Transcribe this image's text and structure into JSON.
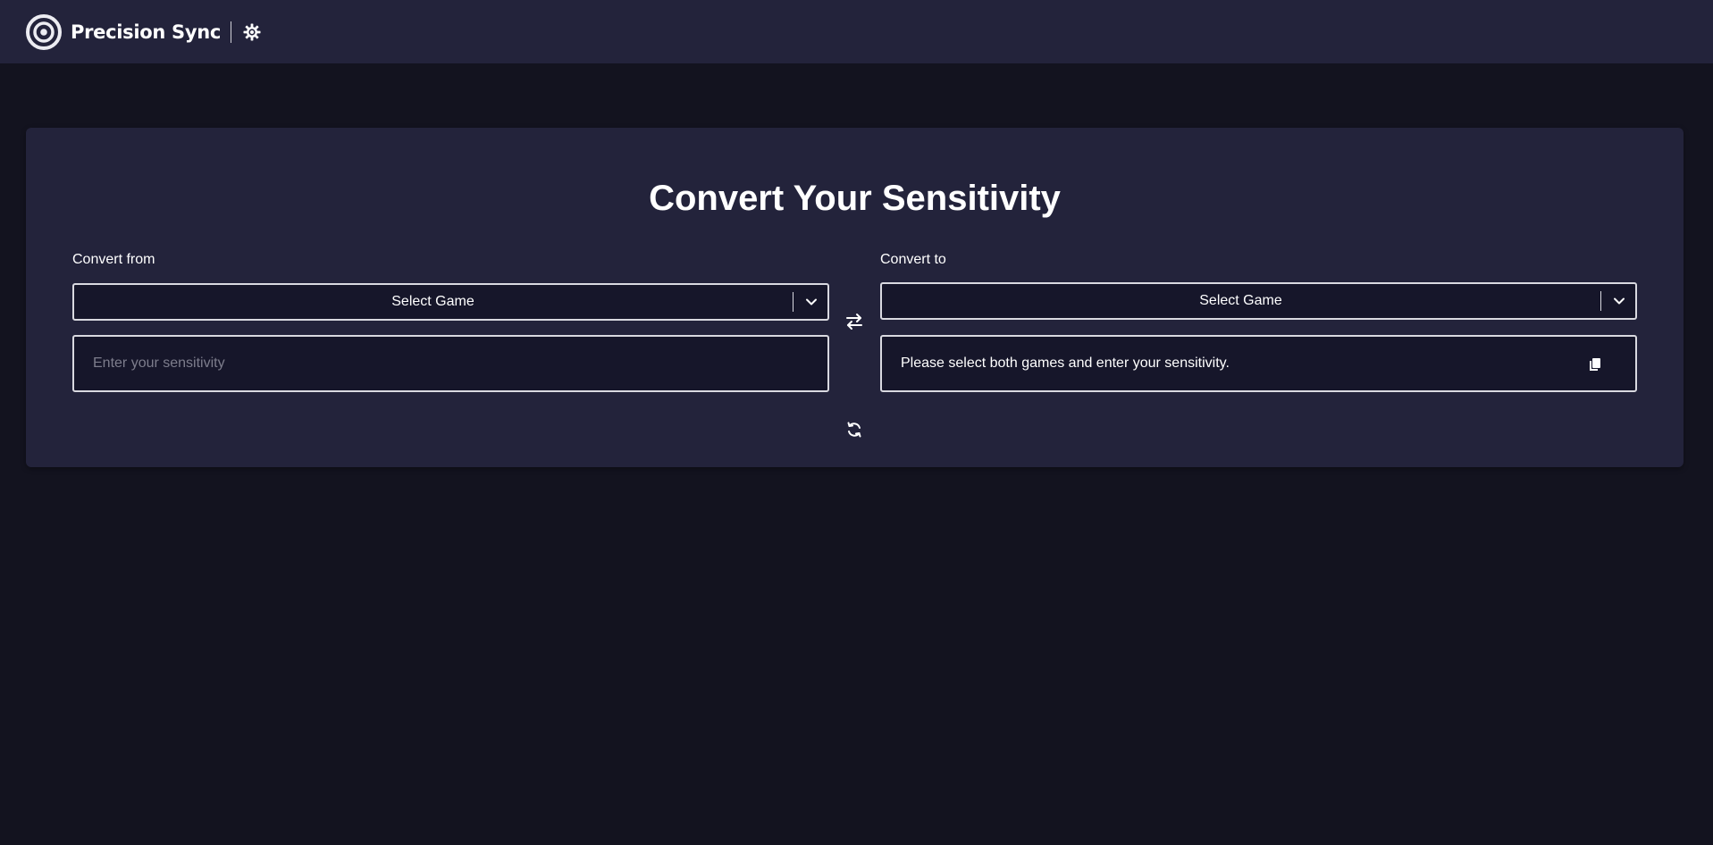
{
  "header": {
    "brand": "Precision Sync",
    "logo_icon": "target-icon",
    "theme_icon": "gear-sun-icon"
  },
  "converter": {
    "title": "Convert Your Sensitivity",
    "from": {
      "label": "Convert from",
      "select_value": "Select Game",
      "input_placeholder": "Enter your sensitivity",
      "input_value": ""
    },
    "to": {
      "label": "Convert to",
      "select_value": "Select Game",
      "result": "Please select both games and enter your sensitivity."
    },
    "swap_icon": "swap-arrows-icon",
    "reset_icon": "refresh-icon",
    "copy_icon": "copy-icon"
  },
  "colors": {
    "background": "#13131f",
    "surface": "#23233b",
    "field": "#16162a",
    "border": "#d9d9e0",
    "placeholder": "#7d7d8c"
  }
}
